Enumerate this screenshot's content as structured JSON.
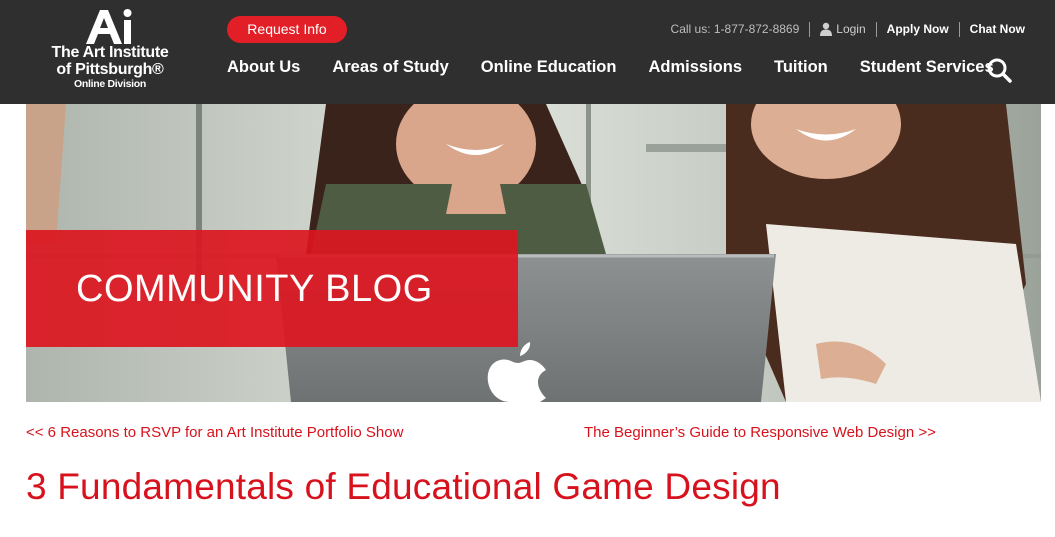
{
  "logo": {
    "mark": "Ai",
    "line1": "The Art Institute",
    "line2": "of Pittsburgh®",
    "line3": "Online Division"
  },
  "header": {
    "request_info": "Request Info",
    "call_us": "Call us: 1-877-872-8869",
    "login": "Login",
    "apply_now": "Apply Now",
    "chat_now": "Chat Now",
    "search_icon": "search-icon"
  },
  "nav": {
    "items": [
      "About Us",
      "Areas of Study",
      "Online Education",
      "Admissions",
      "Tuition",
      "Student Services"
    ]
  },
  "hero": {
    "banner": "COMMUNITY BLOG"
  },
  "post_nav": {
    "prev": "<< 6 Reasons to RSVP for an Art Institute Portfolio Show",
    "next": "The Beginner’s Guide to Responsive Web Design >>"
  },
  "post": {
    "title": "3 Fundamentals of Educational Game Design"
  },
  "colors": {
    "header_bg": "#2f2f2f",
    "brand_red": "#e21f26",
    "link_red": "#d8121c"
  }
}
